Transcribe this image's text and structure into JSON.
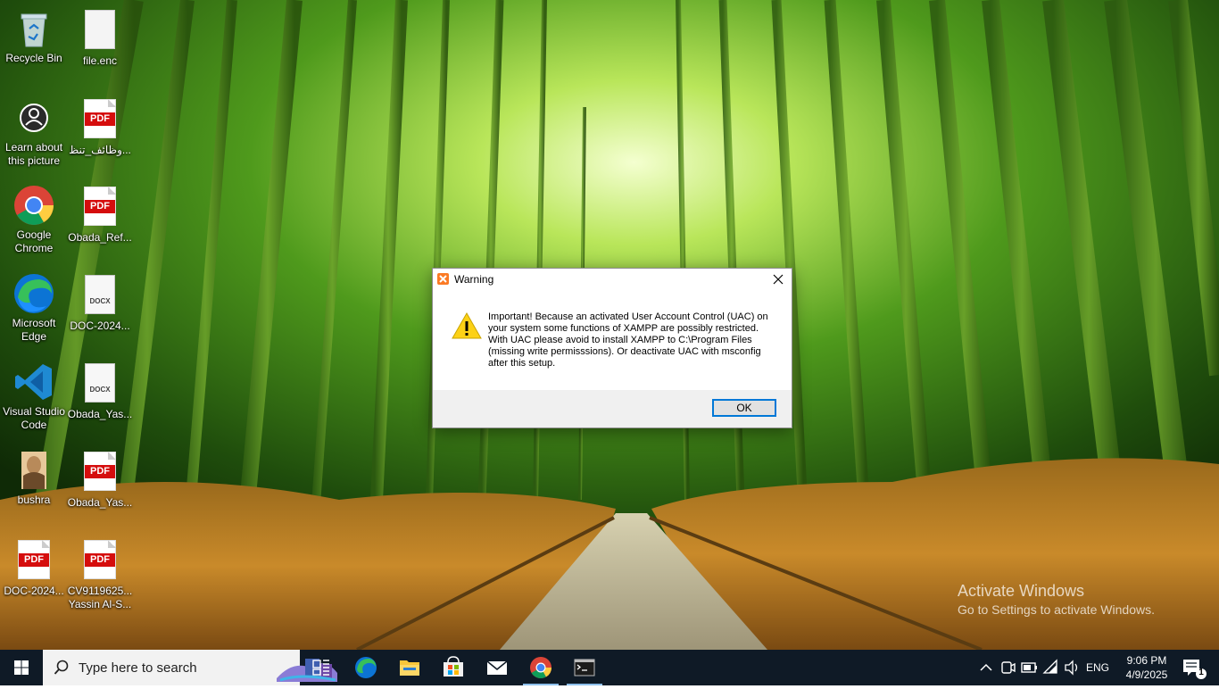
{
  "desktop": {
    "icons": [
      {
        "label": "Recycle Bin",
        "icon": "recycle-bin-icon"
      },
      {
        "label": "file.enc",
        "icon": "file-icon"
      },
      {
        "label": "Learn about this picture",
        "icon": "camera-icon"
      },
      {
        "label": "وظائف_تنظ...",
        "icon": "pdf-file-icon"
      },
      {
        "label": "Google Chrome",
        "icon": "chrome-icon"
      },
      {
        "label": "Obada_Ref...",
        "icon": "pdf-file-icon"
      },
      {
        "label": "Microsoft Edge",
        "icon": "edge-icon"
      },
      {
        "label": "DOC-2024...",
        "icon": "docx-file-icon"
      },
      {
        "label": "Visual Studio Code",
        "icon": "vscode-icon"
      },
      {
        "label": "Obada_Yas...",
        "icon": "docx-file-icon"
      },
      {
        "label": "bushra",
        "icon": "image-file-icon"
      },
      {
        "label": "Obada_Yas...",
        "icon": "pdf-file-icon"
      },
      {
        "label": "DOC-2024...",
        "icon": "pdf-file-icon"
      },
      {
        "label": "CV9119625... Yassin Al-S...",
        "icon": "pdf-file-icon"
      }
    ],
    "pdf_badge": "PDF",
    "docx_badge": "DOCX"
  },
  "dialog": {
    "title": "Warning",
    "message": "Important! Because an activated User Account Control (UAC) on your system some functions of XAMPP are possibly restricted. With UAC please avoid to install XAMPP to C:\\Program Files (missing write permisssions). Or deactivate UAC with msconfig after this setup.",
    "ok_label": "OK",
    "accent": "#0078d7"
  },
  "watermark": {
    "line1": "Activate Windows",
    "line2": "Go to Settings to activate Windows."
  },
  "taskbar": {
    "search_placeholder": "Type here to search",
    "apps": [
      "task-view-icon",
      "edge-icon",
      "file-explorer-icon",
      "store-icon",
      "mail-icon",
      "chrome-icon",
      "terminal-icon"
    ],
    "active_apps": [
      "chrome-icon",
      "terminal-icon"
    ],
    "language": "ENG",
    "time": "9:06 PM",
    "date": "4/9/2025",
    "notification_count": "1"
  }
}
